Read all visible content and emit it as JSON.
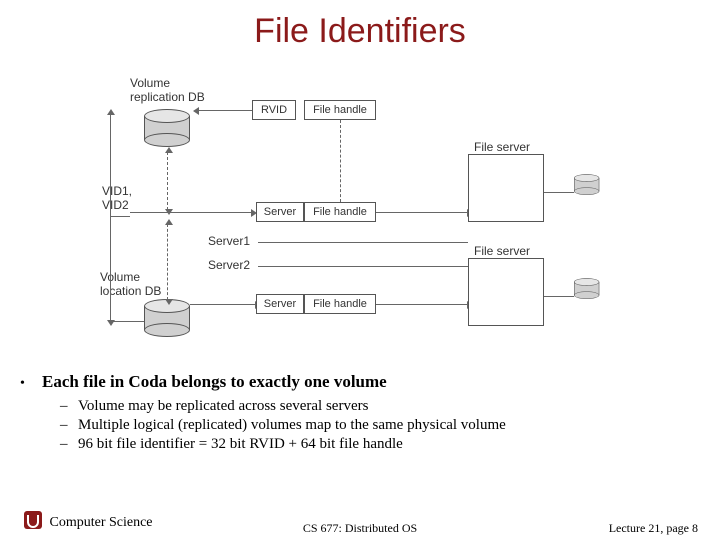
{
  "title": "File Identifiers",
  "diagram": {
    "volume_db": "Volume\nreplication DB",
    "rvid": "RVID",
    "file_handle": "File handle",
    "vid_pair": "VID1,\nVID2",
    "server": "Server",
    "server1": "Server1",
    "server2": "Server2",
    "location_db": "Volume\nlocation DB",
    "file_server": "File server"
  },
  "bullets": {
    "main": "Each file in Coda belongs to exactly one volume",
    "sub": [
      "Volume may be replicated across several servers",
      "Multiple logical (replicated) volumes map to the same physical volume",
      "96 bit file identifier =  32 bit RVID + 64 bit file handle"
    ]
  },
  "footer": {
    "dept": "Computer Science",
    "course": "CS 677: Distributed OS",
    "lecture": "Lecture 21, page 8"
  }
}
